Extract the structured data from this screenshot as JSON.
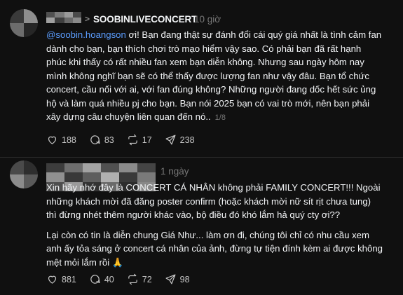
{
  "post1": {
    "target_account": "SOOBINLIVECONCERT",
    "time": "10 giờ",
    "mention": "@soobin.hoangson",
    "lines_after_mention": " ơi! Bạn đang thật sự đánh đổi cái quý giá nhất là tình cảm fan",
    "lines": [
      "dành cho bạn, bạn thích chơi trò mạo hiểm vậy sao. Có phải bạn đã rất hạnh",
      "phúc khi thấy có rất nhiều fan xem bạn diễn không. Nhưng sau ngày hôm nay",
      "mình không nghĩ bạn sẽ có thể thấy được lượng fan như vậy đâu. Bạn tổ chức",
      "concert, cầu nối với ai, với fan đúng không? Những người đang dốc hết sức ủng",
      "hộ và làm quá nhiều pj cho bạn. Bạn nói 2025 bạn có vai trò mới, nên bạn phải"
    ],
    "last_line": "xây dựng câu chuyện liên quan đến nó..",
    "page_indicator": "1/8",
    "likes": "188",
    "comments": "83",
    "reposts": "17",
    "shares": "238"
  },
  "post2": {
    "time": "1 ngày",
    "paragraph1": [
      "Xin hãy nhớ đây là CONCERT CÁ NHÂN không phải FAMILY CONCERT!!! Ngoài",
      "những khách mời đã đăng poster confirm (hoặc khách mời nữ sít rịt chưa tung)",
      "thì đừng nhét thêm người khác vào, bộ điều đó khó lắm hả quý cty ơi??"
    ],
    "paragraph2": [
      "Lại còn có tin là diễn chung Giá Như... làm ơn đi, chúng tôi chỉ có nhu cầu xem",
      "anh ấy tỏa sáng ở concert cá nhân của ảnh, đừng tự tiện đính kèm ai được không",
      "mệt mỏi lắm rồi 🙏"
    ],
    "likes": "881",
    "comments": "40",
    "reposts": "72",
    "shares": "98"
  },
  "icons": [
    "heart-icon",
    "comment-icon",
    "repost-icon",
    "share-icon",
    "chevron-right-icon"
  ],
  "colors": {
    "background": "#101010",
    "text": "#f3f5f7",
    "muted": "#777777",
    "mention": "#5b9dff"
  }
}
